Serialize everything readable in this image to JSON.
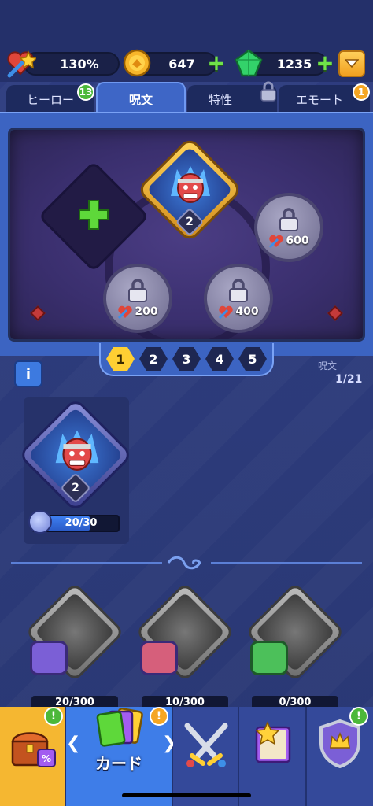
{
  "header": {
    "hp_value": "130%",
    "coins_value": "647",
    "gems_value": "1235"
  },
  "tabs": [
    {
      "label": "ヒーロー",
      "badge": "13"
    },
    {
      "label": "呪文"
    },
    {
      "label": "特性"
    },
    {
      "label": "エモート",
      "badge": "1"
    }
  ],
  "board": {
    "equipped_level": "2",
    "locked_slots": [
      {
        "cost": "600"
      },
      {
        "cost": "200"
      },
      {
        "cost": "400"
      }
    ]
  },
  "pages": [
    "1",
    "2",
    "3",
    "4",
    "5"
  ],
  "active_page": "1",
  "info": {
    "info_label": "i",
    "spell_label": "呪文",
    "spell_count": "1/21"
  },
  "selected_spell": {
    "level": "2",
    "progress_text": "20/30",
    "progress_fraction": 0.667
  },
  "locked_spells": [
    {
      "progress": "20/300"
    },
    {
      "progress": "10/300"
    },
    {
      "progress": "0/300"
    }
  ],
  "bottom_nav": {
    "cards_label": "カード",
    "alert": "!"
  },
  "colors": {
    "accent_blue": "#3e66c6",
    "gold": "#ffcf33",
    "green_plus": "#6fe24a",
    "badge_green": "#4cb83a",
    "badge_orange": "#f5a623"
  }
}
